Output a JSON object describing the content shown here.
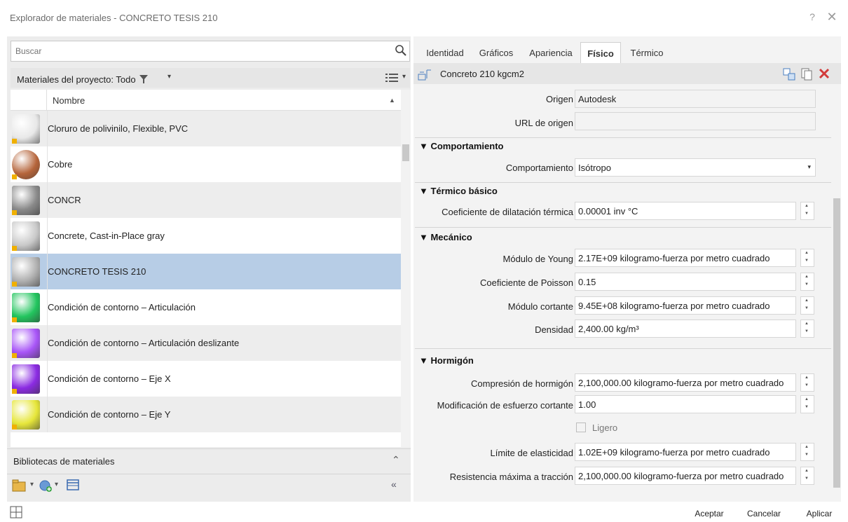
{
  "window": {
    "title": "Explorador de materiales - CONCRETO TESIS 210",
    "help": "?",
    "close": "✕"
  },
  "search": {
    "placeholder": "Buscar"
  },
  "project": {
    "label": "Materiales del proyecto: Todo"
  },
  "table": {
    "column_name": "Nombre"
  },
  "materials": [
    {
      "name": "Cloruro de polivinilo, Flexible, PVC",
      "color": "#e8e8e8"
    },
    {
      "name": "Cobre",
      "color": "#b5643a"
    },
    {
      "name": "CONCR",
      "color": "#8a8a8a"
    },
    {
      "name": "Concrete, Cast-in-Place gray",
      "color": "#c9c9c9"
    },
    {
      "name": "CONCRETO TESIS 210",
      "color": "#b0b0b0"
    },
    {
      "name": "Condición de contorno – Articulación",
      "color": "#22c55e"
    },
    {
      "name": "Condición de contorno – Articulación deslizante",
      "color": "#a855f7"
    },
    {
      "name": "Condición de contorno – Eje X",
      "color": "#8b2be2"
    },
    {
      "name": "Condición de contorno – Eje Y",
      "color": "#e6e63a"
    }
  ],
  "libraries": {
    "label": "Bibliotecas de materiales"
  },
  "tabs": [
    {
      "label": "Identidad"
    },
    {
      "label": "Gráficos"
    },
    {
      "label": "Apariencia"
    },
    {
      "label": "Físico"
    },
    {
      "label": "Térmico"
    }
  ],
  "asset": {
    "name": "Concreto 210 kgcm2"
  },
  "properties": {
    "origen_label": "Origen",
    "origen_value": "Autodesk",
    "url_label": "URL de origen",
    "url_value": "",
    "comportamiento_section": "▼ Comportamiento",
    "comportamiento_label": "Comportamiento",
    "comportamiento_value": "Isótropo",
    "termico_section": "▼ Térmico básico",
    "dilatacion_label": "Coeficiente de dilatación térmica",
    "dilatacion_value": "0.00001 inv °C",
    "mecanico_section": "▼ Mecánico",
    "young_label": "Módulo de Young",
    "young_value": "2.17E+09 kilogramo-fuerza por metro cuadrado",
    "poisson_label": "Coeficiente de Poisson",
    "poisson_value": "0.15",
    "cortante_label": "Módulo cortante",
    "cortante_value": "9.45E+08 kilogramo-fuerza por metro cuadrado",
    "densidad_label": "Densidad",
    "densidad_value": "2,400.00 kg/m³",
    "hormigon_section": "▼ Hormigón",
    "compresion_label": "Compresión de hormigón",
    "compresion_value": "2,100,000.00 kilogramo-fuerza por metro cuadrado",
    "modificacion_label": "Modificación de esfuerzo cortante",
    "modificacion_value": "1.00",
    "ligero_label": "Ligero",
    "elasticidad_label": "Límite de elasticidad",
    "elasticidad_value": "1.02E+09 kilogramo-fuerza por metro cuadrado",
    "traccion_label": "Resistencia máxima a tracción",
    "traccion_value": "2,100,000.00 kilogramo-fuerza por metro cuadrado"
  },
  "footer": {
    "accept": "Aceptar",
    "cancel": "Cancelar",
    "apply": "Aplicar"
  },
  "colors": {
    "selected_row": "#b7cde6",
    "panel_bg": "#ececec"
  }
}
